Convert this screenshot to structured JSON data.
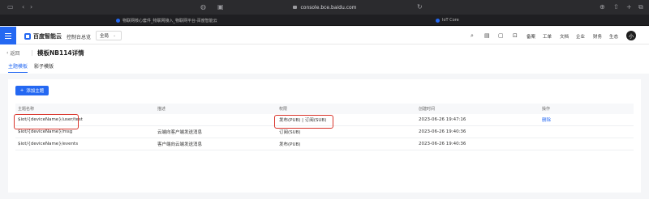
{
  "browser": {
    "url": "console.bce.baidu.com",
    "tabs": [
      {
        "label": "物联网核心套件_物联网接入_物联网平台-百度智能云",
        "color": "#2468f2"
      },
      {
        "label": "IoT Core",
        "color": "#2468f2"
      }
    ]
  },
  "header": {
    "logo": "百度智能云",
    "console": "控制台总览",
    "region": "全局",
    "nav": [
      "备案",
      "工单",
      "文档",
      "企业",
      "财务",
      "生态"
    ],
    "avatar": "小"
  },
  "page": {
    "back": "返回",
    "title": "模板NB114详情",
    "tabs": [
      "主题模板",
      "影子模版"
    ]
  },
  "toolbar": {
    "add_label": "添加主题"
  },
  "table": {
    "columns": [
      "主题名称",
      "描述",
      "权限",
      "创建时间",
      "操作"
    ],
    "rows": [
      {
        "name": "$iot/{deviceName}/user/test",
        "desc": "",
        "perm": "发布(PUB) | 订阅(SUB)",
        "time": "2023-06-26 19:47:16",
        "action": "删除"
      },
      {
        "name": "$iot/{deviceName}/msg",
        "desc": "云端向客户端发送消息",
        "perm": "订阅(SUB)",
        "time": "2023-06-26 19:40:36",
        "action": ""
      },
      {
        "name": "$iot/{deviceName}/events",
        "desc": "客户端向云端发送消息",
        "perm": "发布(PUB)",
        "time": "2023-06-26 19:40:36",
        "action": ""
      }
    ]
  },
  "colors": {
    "accent": "#2468f2",
    "highlight": "#d9342b"
  }
}
